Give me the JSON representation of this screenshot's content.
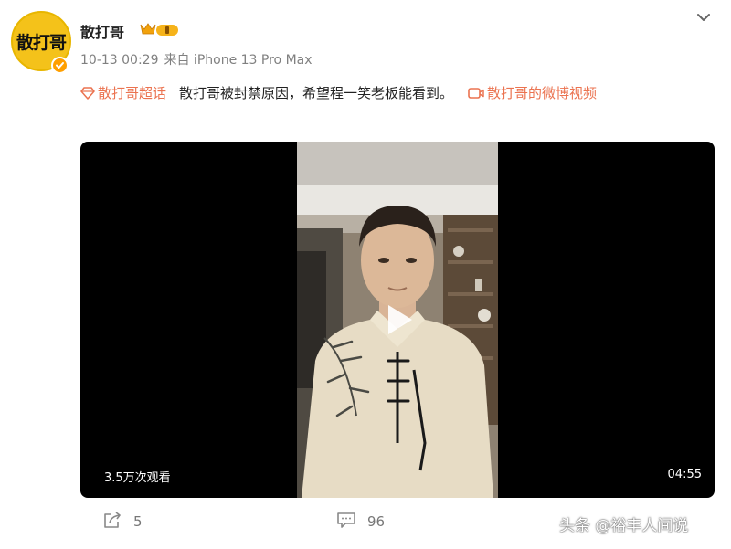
{
  "post": {
    "author": "散打哥",
    "avatar_text": "散打哥",
    "time": "10-13 00:29",
    "source": "来自 iPhone 13 Pro Max",
    "super_topic": "散打哥超话",
    "body": "散打哥被封禁原因，希望程一笑老板能看到。",
    "video_link": "散打哥的微博视频"
  },
  "video": {
    "views": "3.5万次观看",
    "duration": "04:55"
  },
  "actions": {
    "share_count": "5",
    "comment_count": "96"
  },
  "watermark": "头条 @裕丰人间说",
  "colors": {
    "accent": "#eb7350",
    "avatar_bg": "#f4c21a",
    "muted": "#808080"
  },
  "icons": {
    "super_topic": "diamond-icon",
    "video_link": "video-icon",
    "share": "share-icon",
    "comment": "comment-icon",
    "dropdown": "chevron-down-icon",
    "play": "play-icon"
  }
}
